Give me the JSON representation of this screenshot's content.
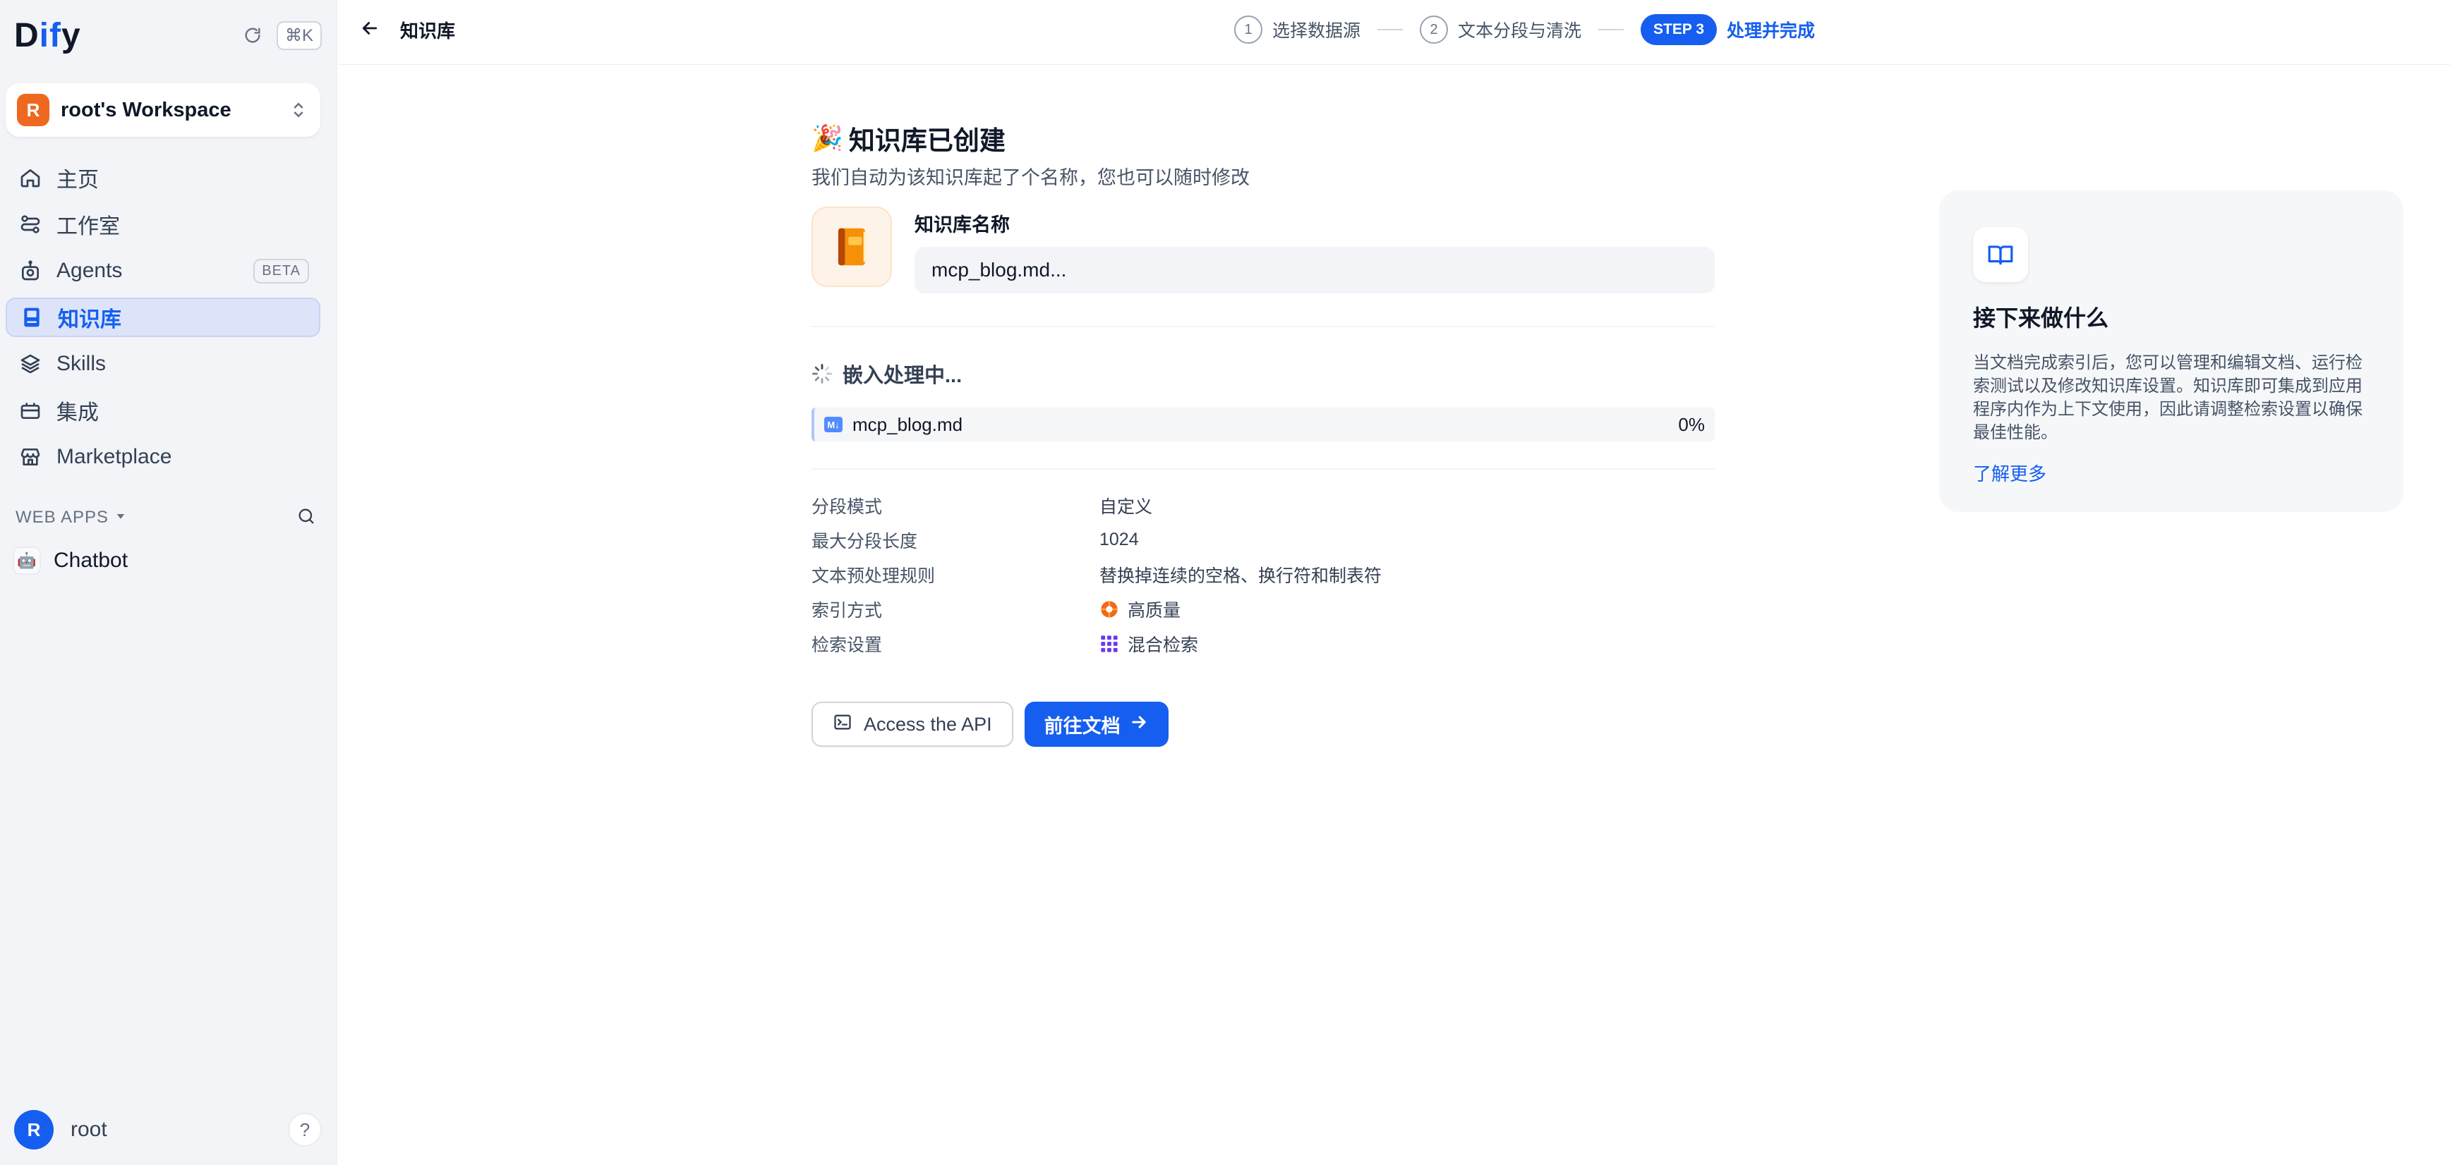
{
  "sidebar": {
    "logo": {
      "part1": "D",
      "part2": "if",
      "part3": "y"
    },
    "shortcut": "⌘K",
    "workspace": {
      "initial": "R",
      "name": "root's Workspace"
    },
    "nav": [
      {
        "label": "主页"
      },
      {
        "label": "工作室"
      },
      {
        "label": "Agents",
        "badge": "BETA"
      },
      {
        "label": "知识库",
        "active": true
      },
      {
        "label": "Skills"
      },
      {
        "label": "集成"
      },
      {
        "label": "Marketplace"
      }
    ],
    "web_apps_label": "WEB APPS",
    "apps": [
      {
        "name": "Chatbot"
      }
    ],
    "user": {
      "initial": "R",
      "name": "root"
    },
    "help": "?"
  },
  "topbar": {
    "back_label": "知识库",
    "steps": [
      {
        "num": "1",
        "label": "选择数据源"
      },
      {
        "num": "2",
        "label": "文本分段与清洗"
      },
      {
        "num": "STEP 3",
        "label": "处理并完成"
      }
    ]
  },
  "main": {
    "title_emoji": "🎉",
    "title": "知识库已创建",
    "subtitle": "我们自动为该知识库起了个名称，您也可以随时修改",
    "name_label": "知识库名称",
    "name_value": "mcp_blog.md...",
    "embed_title": "嵌入处理中...",
    "file": {
      "icon": "M↓",
      "name": "mcp_blog.md",
      "progress": "0%"
    },
    "info": [
      {
        "key": "分段模式",
        "value": "自定义"
      },
      {
        "key": "最大分段长度",
        "value": "1024"
      },
      {
        "key": "文本预处理规则",
        "value": "替换掉连续的空格、换行符和制表符"
      },
      {
        "key": "索引方式",
        "value": "高质量",
        "icon": "high-quality-icon"
      },
      {
        "key": "检索设置",
        "value": "混合检索",
        "icon": "hybrid-search-icon"
      }
    ],
    "api_button": "Access the API",
    "doc_button": "前往文档"
  },
  "next_panel": {
    "title": "接下来做什么",
    "description": "当文档完成索引后，您可以管理和编辑文档、运行检索测试以及修改知识库设置。知识库即可集成到应用程序内作为上下文使用，因此请调整检索设置以确保最佳性能。",
    "link": "了解更多"
  },
  "colors": {
    "accent": "#155eef",
    "sidebar_bg": "#f2f4f7",
    "workspace_avatar": "#ef6820"
  }
}
